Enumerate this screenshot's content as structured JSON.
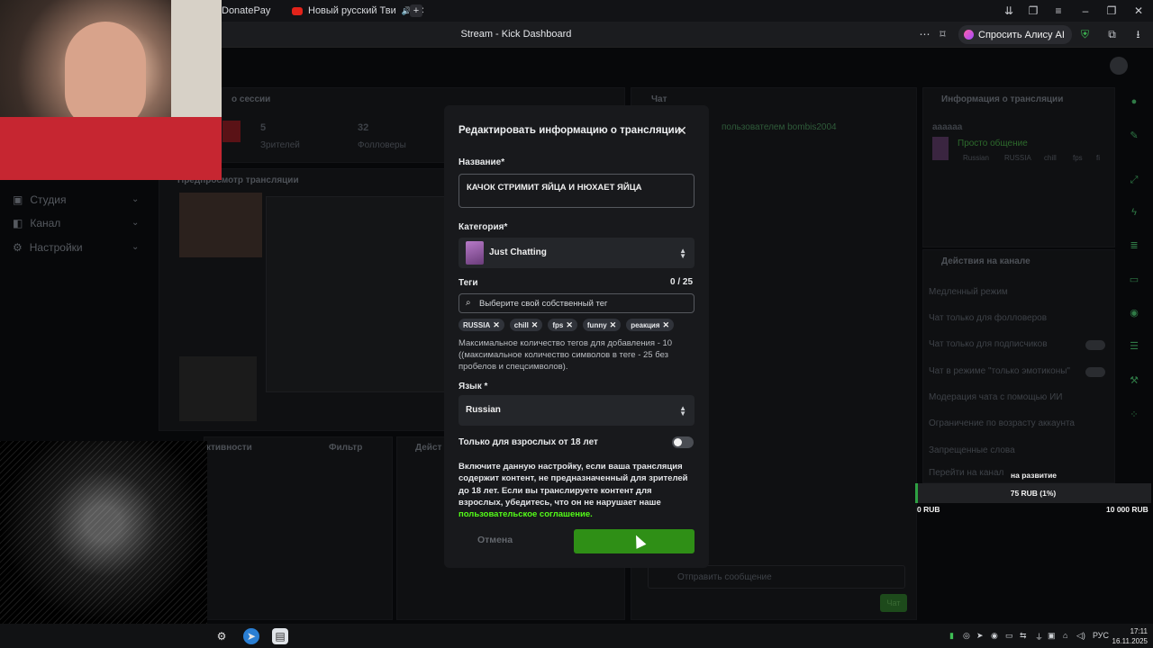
{
  "browser": {
    "tabs": [
      {
        "label": "DonatePay"
      },
      {
        "label": "Новый русский Тви"
      }
    ],
    "window_title": "Stream - Kick Dashboard",
    "alice_button": "Спросить Алису AI"
  },
  "sidebar": {
    "items": [
      {
        "label": "Студия"
      },
      {
        "label": "Канал"
      },
      {
        "label": "Настройки"
      }
    ]
  },
  "background": {
    "session_title": "о сессии",
    "viewers_count": "5",
    "viewers_label": "Зрителей",
    "followers_count": "32",
    "followers_label": "Фолловеры",
    "preview_title": "Предпросмотр трансляции",
    "chat_title": "Чат",
    "chat_pinned": "пользователем bombis2004",
    "activity_title": "ктивности",
    "filter_label": "Фильтр",
    "actions_short": "Дейст",
    "chat_placeholder": "Отправить сообщение",
    "chat_send": "Чат",
    "info_panel_title": "Информация о трансляции",
    "info_name": "аааааа",
    "info_category": "Просто общение",
    "info_tags": [
      "Russian",
      "RUSSIA",
      "chill",
      "fps",
      "fi"
    ],
    "channel_actions_title": "Действия на канале",
    "channel_actions": [
      {
        "label": "Медленный режим"
      },
      {
        "label": "Чат только для фолловеров"
      },
      {
        "label": "Чат только для подписчиков"
      },
      {
        "label": "Чат в режиме \"только эмотиконы\""
      },
      {
        "label": "Модерация чата с помощью ИИ"
      },
      {
        "label": "Ограничение по возрасту аккаунта"
      },
      {
        "label": "Запрещенные слова"
      },
      {
        "label": "Перейти на канал"
      }
    ]
  },
  "modal": {
    "title": "Редактировать информацию о трансляции",
    "name_label": "Название*",
    "name_value": "КАЧОК СТРИМИТ ЯЙЦА И НЮХАЕТ ЯЙЦА",
    "category_label": "Категория*",
    "category_value": "Just Chatting",
    "tags_label": "Теги",
    "tags_count": "0 / 25",
    "tag_placeholder": "Выберите свой собственный тег",
    "tags": [
      "RUSSIA",
      "chill",
      "fps",
      "funny",
      "реакция"
    ],
    "tags_help": "Максимальное количество тегов для добавления - 10 ((максимальное количество символов в теге - 25 без пробелов и спецсимволов).",
    "language_label": "Язык *",
    "language_value": "Russian",
    "adult_label": "Только для взрослых от 18 лет",
    "adult_enabled": false,
    "adult_help": "Включите данную настройку, если ваша трансляция содержит контент, не предназначенный для зрителей до 18 лет. Если вы транслируете контент для взрослых, убедитесь, что он не нарушает наше",
    "adult_link": "пользовательское соглашение.",
    "cancel_label": "Отмена"
  },
  "donation_goal": {
    "title": "на развитие",
    "progress_text": "75 RUB (1%)",
    "progress_fraction": 0.01,
    "min_label": "0 RUB",
    "max_label": "10 000 RUB"
  },
  "taskbar": {
    "lang": "РУС",
    "time": "17:11",
    "date": "16.11.2025"
  },
  "colors": {
    "accent_green": "#53fc18",
    "button_green": "#2f8f16",
    "youtube_red": "#e2231a"
  }
}
